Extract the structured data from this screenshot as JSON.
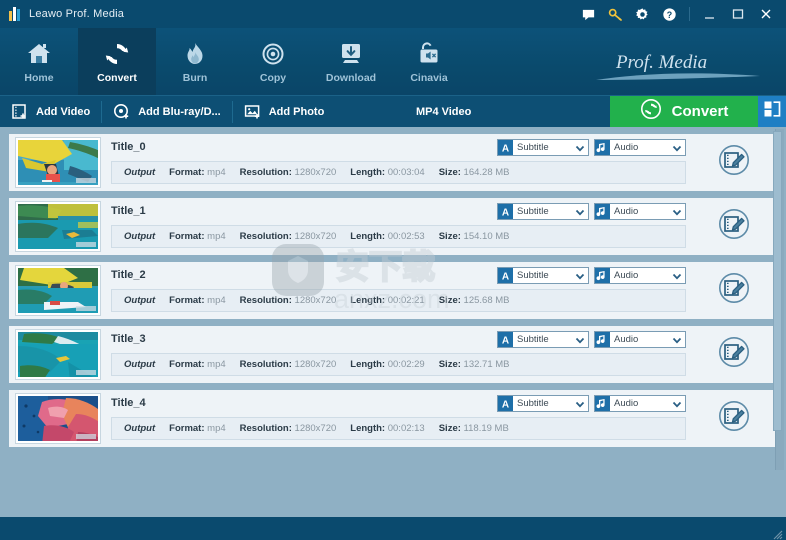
{
  "window": {
    "title": "Leawo Prof. Media",
    "icons": {
      "logo": "app-logo-icon",
      "feedback": "chat-bubble-icon",
      "key": "key-icon",
      "settings": "gear-icon",
      "help": "help-circle-icon",
      "minimize": "minimize-icon",
      "maximize": "maximize-icon",
      "close": "close-icon"
    }
  },
  "nav": {
    "brand": "Prof. Media",
    "items": [
      {
        "label": "Home",
        "icon": "home-icon",
        "active": false
      },
      {
        "label": "Convert",
        "icon": "convert-arrows-icon",
        "active": true
      },
      {
        "label": "Burn",
        "icon": "flame-icon",
        "active": false
      },
      {
        "label": "Copy",
        "icon": "disc-icon",
        "active": false
      },
      {
        "label": "Download",
        "icon": "download-icon",
        "active": false
      },
      {
        "label": "Cinavia",
        "icon": "mute-lock-icon",
        "active": false
      }
    ]
  },
  "toolbar": {
    "add_video": "Add Video",
    "add_bluray": "Add Blu-ray/D...",
    "add_photo": "Add Photo",
    "format_label": "MP4 Video",
    "convert_label": "Convert",
    "icons": {
      "add_video": "add-video-icon",
      "add_bluray": "add-disc-icon",
      "add_photo": "add-photo-icon",
      "convert": "convert-circle-icon",
      "panel_toggle": "panel-toggle-icon"
    }
  },
  "list": {
    "labels": {
      "output": "Output",
      "format": "Format:",
      "resolution": "Resolution:",
      "length": "Length:",
      "size": "Size:"
    },
    "subtitle_select": {
      "value": "Subtitle",
      "icon": "subtitle-a-icon"
    },
    "audio_select": {
      "value": "Audio",
      "icon": "audio-note-icon"
    },
    "edit_icon": "edit-video-icon",
    "rows": [
      {
        "title": "Title_0",
        "format": "mp4",
        "resolution": "1280x720",
        "length": "00:03:04",
        "size": "164.28 MB",
        "thumb": "hang-glider-over-lagoon"
      },
      {
        "title": "Title_1",
        "format": "mp4",
        "resolution": "1280x720",
        "length": "00:02:53",
        "size": "154.10 MB",
        "thumb": "aerial-reef-with-plane-wing"
      },
      {
        "title": "Title_2",
        "format": "mp4",
        "resolution": "1280x720",
        "length": "00:02:21",
        "size": "125.68 MB",
        "thumb": "yellow-seaplane-over-bay"
      },
      {
        "title": "Title_3",
        "format": "mp4",
        "resolution": "1280x720",
        "length": "00:02:29",
        "size": "132.71 MB",
        "thumb": "aerial-island-sandbar"
      },
      {
        "title": "Title_4",
        "format": "mp4",
        "resolution": "1280x720",
        "length": "00:02:13",
        "size": "118.19 MB",
        "thumb": "pink-coral-reef"
      }
    ]
  },
  "watermark": {
    "text": "anxz.com"
  },
  "colors": {
    "titlebar": "#0a4a6e",
    "nav": "#0c5279",
    "nav_active": "#0b3e5c",
    "toolbar": "#0d4f74",
    "convert_green": "#22b14c",
    "panel_blue": "#1f7fc4",
    "list_bg": "#8fb0c4",
    "row_bg": "#eef3f7"
  }
}
